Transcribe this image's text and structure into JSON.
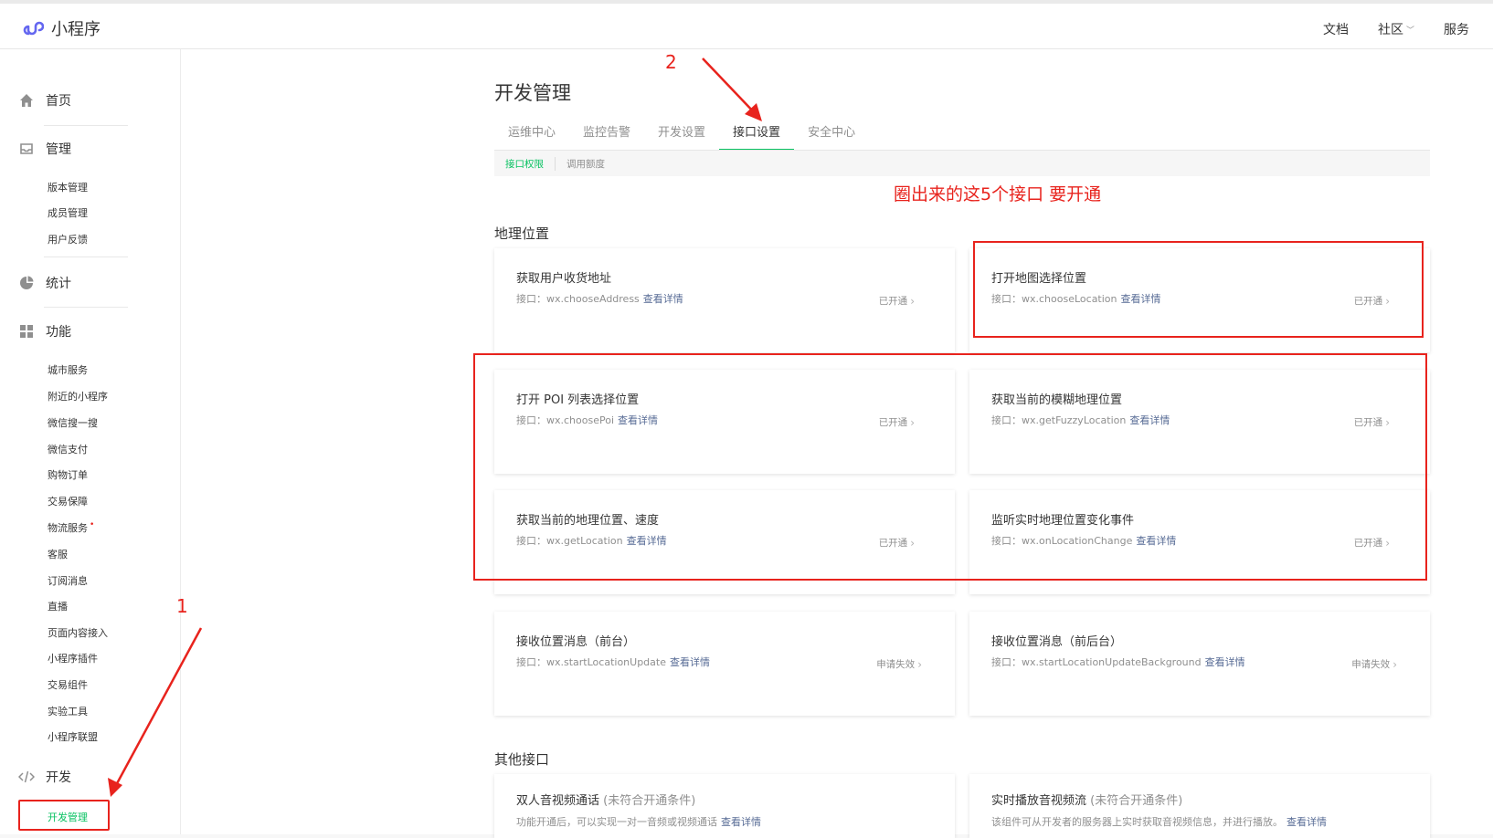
{
  "app": {
    "logo_text": "小程序"
  },
  "topnav": {
    "docs": "文档",
    "community": "社区",
    "service": "服务"
  },
  "sidebar": {
    "home": "首页",
    "manage": "管理",
    "manage_items": [
      "版本管理",
      "成员管理",
      "用户反馈"
    ],
    "stats": "统计",
    "features": "功能",
    "feature_items": [
      "城市服务",
      "附近的小程序",
      "微信搜一搜",
      "微信支付",
      "购物订单",
      "交易保障",
      "物流服务",
      "客服",
      "订阅消息",
      "直播",
      "页面内容接入",
      "小程序插件",
      "交易组件",
      "实验工具",
      "小程序联盟"
    ],
    "dev": "开发",
    "dev_active": "开发管理"
  },
  "main": {
    "title": "开发管理",
    "tabs": [
      "运维中心",
      "监控告警",
      "开发设置",
      "接口设置",
      "安全中心"
    ],
    "subtabs": [
      "接口权限",
      "调用额度"
    ]
  },
  "annotations": {
    "step1": "1",
    "step2": "2",
    "instruction": "圈出来的这5个接口 要开通"
  },
  "sections": {
    "location": "地理位置",
    "other": "其他接口"
  },
  "api_prefix": "接口：",
  "detail_link": "查看详情",
  "cards": [
    {
      "title": "获取用户收货地址",
      "api": "wx.chooseAddress",
      "status": "已开通"
    },
    {
      "title": "打开地图选择位置",
      "api": "wx.chooseLocation",
      "status": "已开通"
    },
    {
      "title": "打开 POI 列表选择位置",
      "api": "wx.choosePoi",
      "status": "已开通"
    },
    {
      "title": "获取当前的模糊地理位置",
      "api": "wx.getFuzzyLocation",
      "status": "已开通"
    },
    {
      "title": "获取当前的地理位置、速度",
      "api": "wx.getLocation",
      "status": "已开通"
    },
    {
      "title": "监听实时地理位置变化事件",
      "api": "wx.onLocationChange",
      "status": "已开通"
    },
    {
      "title": "接收位置消息（前台）",
      "api": "wx.startLocationUpdate",
      "status": "申请失效"
    },
    {
      "title": "接收位置消息（前后台）",
      "api": "wx.startLocationUpdateBackground",
      "status": "申请失效"
    }
  ],
  "other_cards": [
    {
      "title": "双人音视频通话",
      "note": "(未符合开通条件)",
      "desc": "功能开通后，可以实现一对一音频或视频通话"
    },
    {
      "title": "实时播放音视频流",
      "note": "(未符合开通条件)",
      "desc": "该组件可从开发者的服务器上实时获取音视频信息，并进行播放。"
    }
  ],
  "colors": {
    "accent": "#07c160",
    "annotation": "#e8231d",
    "link": "#576b95"
  }
}
